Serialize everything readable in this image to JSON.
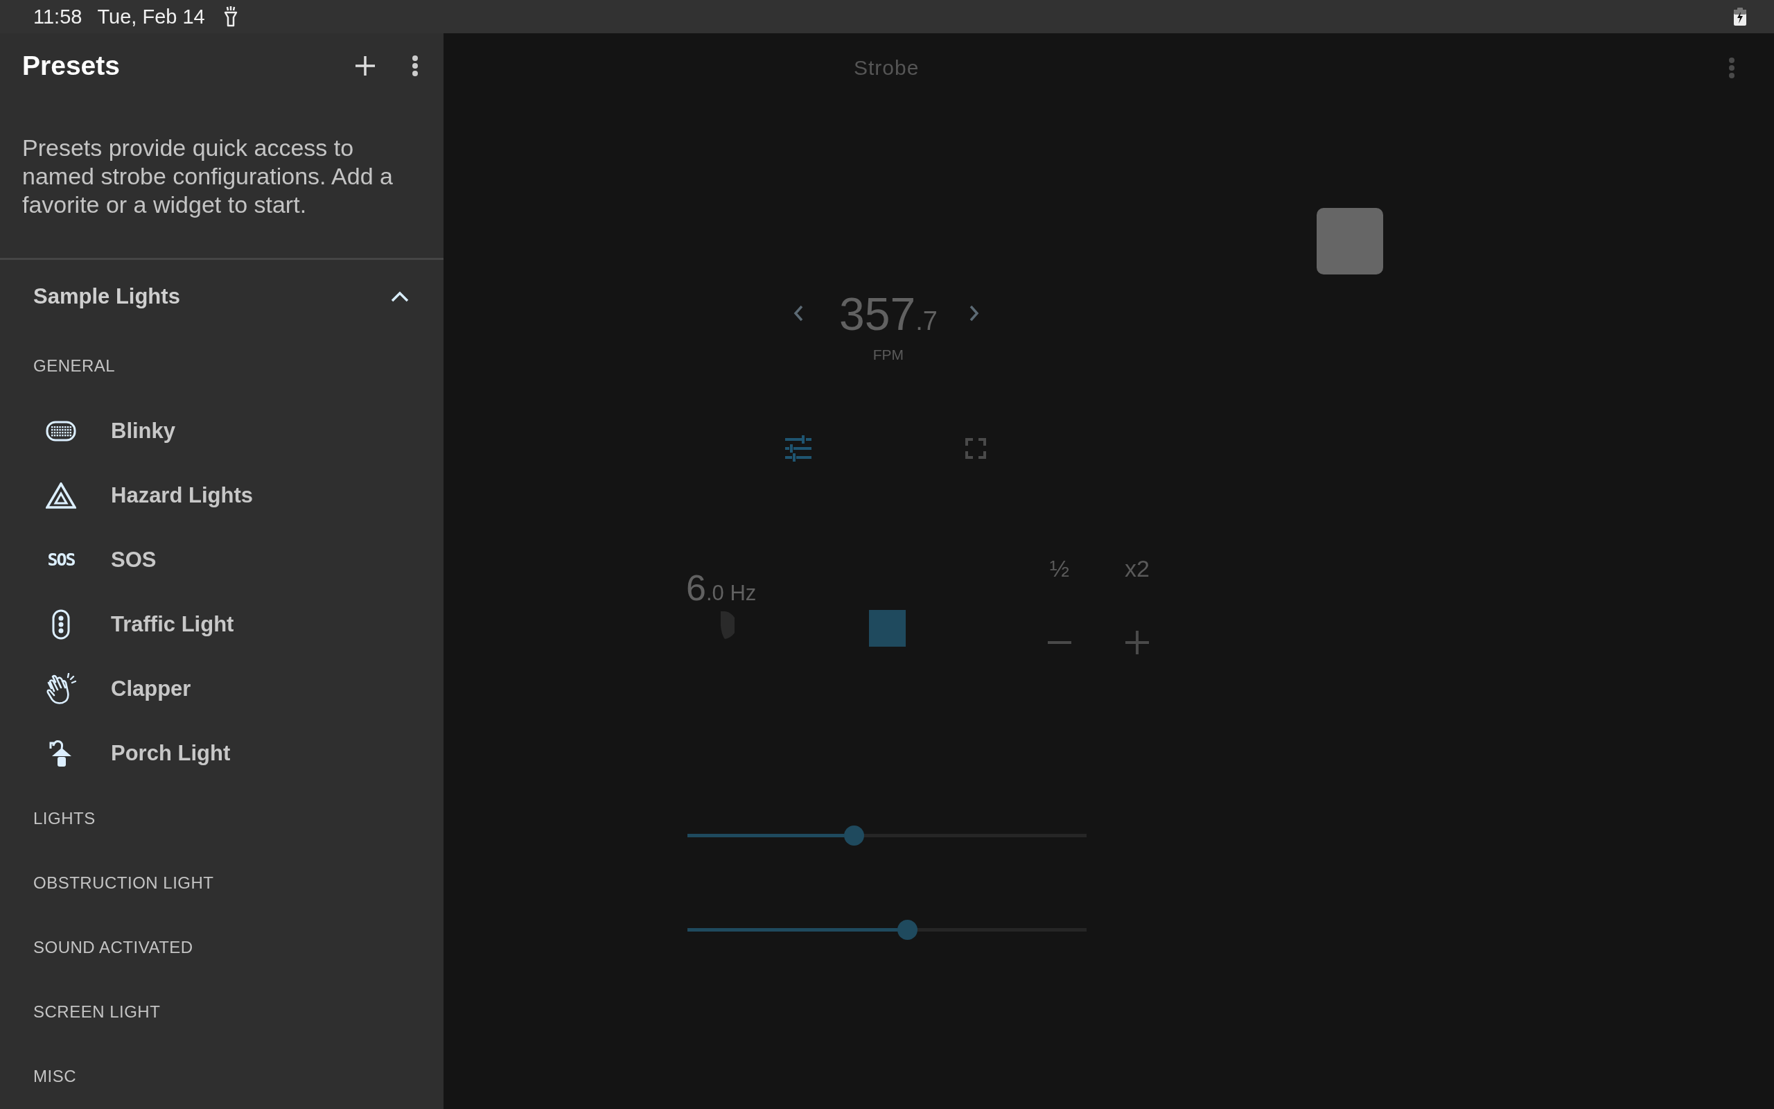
{
  "status_bar": {
    "time": "11:58",
    "date": "Tue, Feb 14"
  },
  "sidebar": {
    "title": "Presets",
    "description": "Presets provide quick access to named strobe configurations. Add a favorite or a widget to start.",
    "group": {
      "title": "Sample Lights",
      "expanded": true,
      "sections": [
        {
          "label": "GENERAL",
          "items": [
            {
              "label": "Blinky"
            },
            {
              "label": "Hazard Lights"
            },
            {
              "label": "SOS",
              "icon_text": "SOS"
            },
            {
              "label": "Traffic Light"
            },
            {
              "label": "Clapper"
            },
            {
              "label": "Porch Light"
            }
          ]
        },
        {
          "label": "LIGHTS"
        },
        {
          "label": "OBSTRUCTION LIGHT"
        },
        {
          "label": "SOUND ACTIVATED"
        },
        {
          "label": "SCREEN LIGHT"
        },
        {
          "label": "MISC"
        }
      ]
    }
  },
  "main": {
    "title": "Strobe",
    "rate": {
      "whole": "357",
      "fraction": ".7",
      "unit": "FPM"
    },
    "tools": [
      {
        "selected": true
      },
      {
        "selected": false
      }
    ],
    "frequency": {
      "whole": "6",
      "fraction": ".0",
      "unit": "Hz"
    },
    "multipliers": [
      "½",
      "x2"
    ],
    "sliders": [
      {
        "level": 0.417
      },
      {
        "level": 0.55
      }
    ]
  }
}
